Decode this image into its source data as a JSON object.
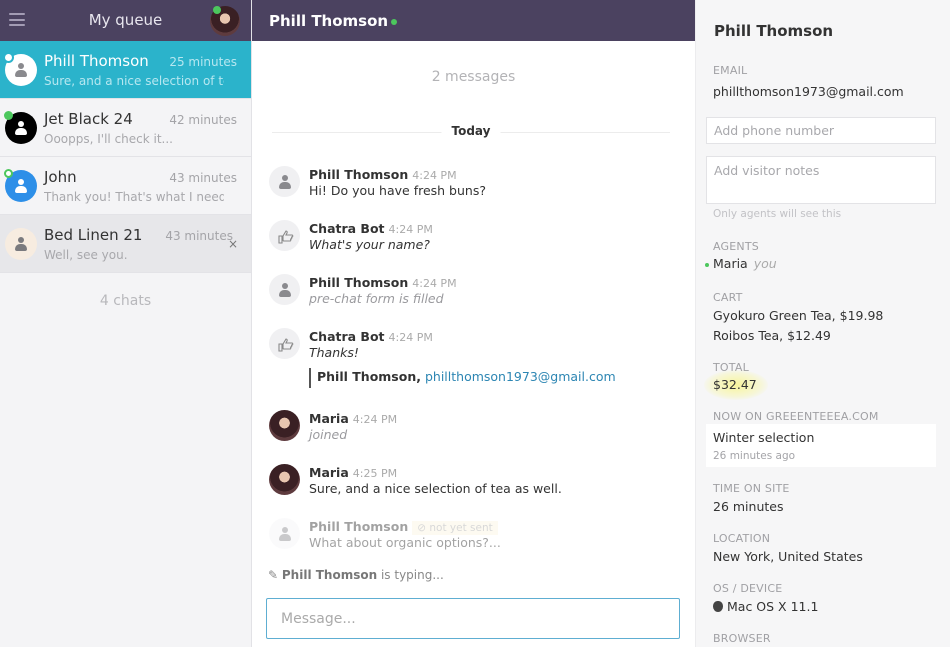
{
  "queue": {
    "title": "My queue",
    "menu_icon": "hamburger-menu-icon",
    "agent_avatar_status": "online",
    "chats": [
      {
        "name": "Phill Thomson",
        "time": "25 minutes",
        "preview": "Sure, and a nice selection of tea ...",
        "status": "online",
        "active": true
      },
      {
        "name": "Jet Black 24",
        "time": "42 minutes",
        "preview": "Ooopps, I'll check it...",
        "status": "online"
      },
      {
        "name": "John",
        "time": "43 minutes",
        "preview": "Thank you! That's what I need :-)",
        "status": "away"
      },
      {
        "name": "Bed Linen 21",
        "time": "43 minutes",
        "preview": "Well, see you.",
        "close": "×"
      }
    ],
    "count": "4 chats"
  },
  "chat": {
    "title": "Phill Thomson",
    "message_count": "2 messages",
    "day_label": "Today",
    "messages": [
      {
        "author": "Phill Thomson",
        "time": "4:24 PM",
        "text": "Hi! Do you have fresh buns?"
      },
      {
        "author": "Chatra Bot",
        "time": "4:24 PM",
        "text": "What's your name?"
      },
      {
        "author": "Phill Thomson",
        "time": "4:24 PM",
        "text": "pre-chat form is filled"
      },
      {
        "author": "Chatra Bot",
        "time": "4:24 PM",
        "text": "Thanks!",
        "quote_name": "Phill Thomson,",
        "quote_email": "phillthomson1973@gmail.com"
      },
      {
        "author": "Maria",
        "time": "4:24 PM",
        "text": "joined"
      },
      {
        "author": "Maria",
        "time": "4:25 PM",
        "text": "Sure, and a nice selection of tea as well."
      },
      {
        "author": "Phill Thomson",
        "badge": "not yet sent",
        "text": "What about organic options?..."
      }
    ],
    "typing_name": "Phill Thomson",
    "typing_suffix": " is typing...",
    "input_placeholder": "Message..."
  },
  "visitor": {
    "name": "Phill Thomson",
    "email_label": "EMAIL",
    "email": "phillthomson1973@gmail.com",
    "phone_placeholder": "Add phone number",
    "notes_placeholder": "Add visitor notes",
    "notes_hint": "Only agents will see this",
    "agents_label": "AGENTS",
    "agent_name": "Maria",
    "agent_you": "you",
    "cart_label": "CART",
    "cart_items": [
      "Gyokuro Green Tea, $19.98",
      "Roibos Tea, $12.49"
    ],
    "total_label": "TOTAL",
    "total": "$32.47",
    "now_on_label": "NOW ON GREEENTEEEA.COM",
    "now_on_page": "Winter selection",
    "now_on_ago": "26 minutes ago",
    "time_on_site_label": "TIME ON SITE",
    "time_on_site": "26 minutes",
    "location_label": "LOCATION",
    "location": "New York, United States",
    "os_label": "OS / DEVICE",
    "os": "Mac OS X 11.1",
    "browser_label": "BROWSER"
  },
  "colors": {
    "header_bg": "#4b4260",
    "active_chat": "#2bb3cb",
    "online": "#4cc75d",
    "link": "#2d86b3",
    "input_border": "#5eaed2"
  }
}
